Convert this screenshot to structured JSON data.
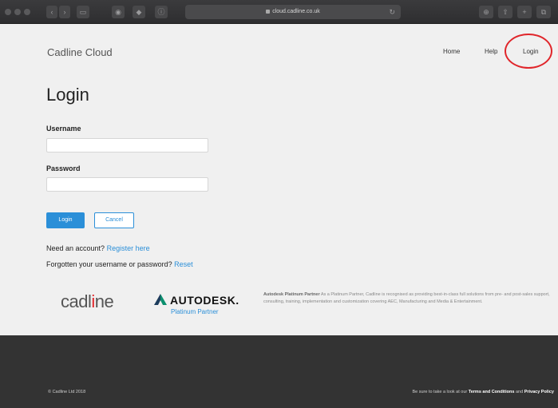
{
  "browser": {
    "url": "cloud.cadline.co.uk"
  },
  "header": {
    "brand": "Cadline Cloud",
    "nav": [
      "Home",
      "Help",
      "Login"
    ]
  },
  "form": {
    "title": "Login",
    "username_label": "Username",
    "username_value": "",
    "password_label": "Password",
    "password_value": "",
    "login_button": "Login",
    "cancel_button": "Cancel",
    "need_account": "Need an account?",
    "register_link": "Register here",
    "forgot_text": "Forgotten your username or password?",
    "reset_link": "Reset"
  },
  "partners": {
    "cadline_logo_pre": "cadl",
    "cadline_logo_hi": "i",
    "cadline_logo_post": "ne",
    "autodesk_name": "AUTODESK.",
    "autodesk_sub": "Platinum Partner",
    "blurb_title": "Autodesk Platinum Partner",
    "blurb_body": "As a Platinum Partner, Cadline is recognised as providing best-in-class full solutions from pre- and post-sales support, consulting, training, implementation and customization covering AEC, Manufacturing and Media & Entertainment."
  },
  "footer": {
    "copyright": "© Cadline Ltd 2018",
    "terms_prefix": "Be sure to take a look at our",
    "terms_link": "Terms and Conditions",
    "terms_and": "and",
    "privacy_link": "Privacy Policy"
  },
  "colors": {
    "accent": "#2b8fd8",
    "highlight_circle": "#e0262b",
    "footer_bg": "#333333"
  }
}
